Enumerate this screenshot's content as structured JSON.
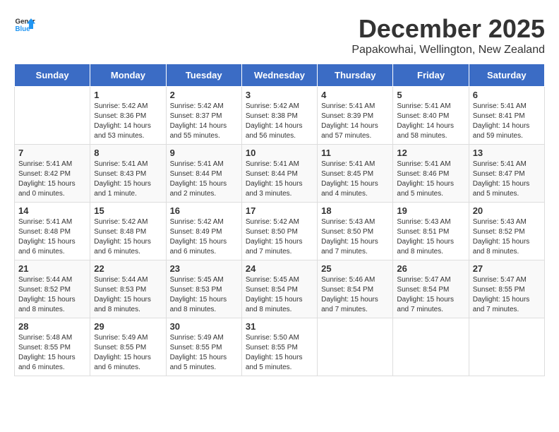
{
  "logo": {
    "text_general": "General",
    "text_blue": "Blue"
  },
  "title": "December 2025",
  "subtitle": "Papakowhai, Wellington, New Zealand",
  "headers": [
    "Sunday",
    "Monday",
    "Tuesday",
    "Wednesday",
    "Thursday",
    "Friday",
    "Saturday"
  ],
  "weeks": [
    [
      {
        "day": "",
        "info": ""
      },
      {
        "day": "1",
        "info": "Sunrise: 5:42 AM\nSunset: 8:36 PM\nDaylight: 14 hours\nand 53 minutes."
      },
      {
        "day": "2",
        "info": "Sunrise: 5:42 AM\nSunset: 8:37 PM\nDaylight: 14 hours\nand 55 minutes."
      },
      {
        "day": "3",
        "info": "Sunrise: 5:42 AM\nSunset: 8:38 PM\nDaylight: 14 hours\nand 56 minutes."
      },
      {
        "day": "4",
        "info": "Sunrise: 5:41 AM\nSunset: 8:39 PM\nDaylight: 14 hours\nand 57 minutes."
      },
      {
        "day": "5",
        "info": "Sunrise: 5:41 AM\nSunset: 8:40 PM\nDaylight: 14 hours\nand 58 minutes."
      },
      {
        "day": "6",
        "info": "Sunrise: 5:41 AM\nSunset: 8:41 PM\nDaylight: 14 hours\nand 59 minutes."
      }
    ],
    [
      {
        "day": "7",
        "info": "Sunrise: 5:41 AM\nSunset: 8:42 PM\nDaylight: 15 hours\nand 0 minutes."
      },
      {
        "day": "8",
        "info": "Sunrise: 5:41 AM\nSunset: 8:43 PM\nDaylight: 15 hours\nand 1 minute."
      },
      {
        "day": "9",
        "info": "Sunrise: 5:41 AM\nSunset: 8:44 PM\nDaylight: 15 hours\nand 2 minutes."
      },
      {
        "day": "10",
        "info": "Sunrise: 5:41 AM\nSunset: 8:44 PM\nDaylight: 15 hours\nand 3 minutes."
      },
      {
        "day": "11",
        "info": "Sunrise: 5:41 AM\nSunset: 8:45 PM\nDaylight: 15 hours\nand 4 minutes."
      },
      {
        "day": "12",
        "info": "Sunrise: 5:41 AM\nSunset: 8:46 PM\nDaylight: 15 hours\nand 5 minutes."
      },
      {
        "day": "13",
        "info": "Sunrise: 5:41 AM\nSunset: 8:47 PM\nDaylight: 15 hours\nand 5 minutes."
      }
    ],
    [
      {
        "day": "14",
        "info": "Sunrise: 5:41 AM\nSunset: 8:48 PM\nDaylight: 15 hours\nand 6 minutes."
      },
      {
        "day": "15",
        "info": "Sunrise: 5:42 AM\nSunset: 8:48 PM\nDaylight: 15 hours\nand 6 minutes."
      },
      {
        "day": "16",
        "info": "Sunrise: 5:42 AM\nSunset: 8:49 PM\nDaylight: 15 hours\nand 6 minutes."
      },
      {
        "day": "17",
        "info": "Sunrise: 5:42 AM\nSunset: 8:50 PM\nDaylight: 15 hours\nand 7 minutes."
      },
      {
        "day": "18",
        "info": "Sunrise: 5:43 AM\nSunset: 8:50 PM\nDaylight: 15 hours\nand 7 minutes."
      },
      {
        "day": "19",
        "info": "Sunrise: 5:43 AM\nSunset: 8:51 PM\nDaylight: 15 hours\nand 8 minutes."
      },
      {
        "day": "20",
        "info": "Sunrise: 5:43 AM\nSunset: 8:52 PM\nDaylight: 15 hours\nand 8 minutes."
      }
    ],
    [
      {
        "day": "21",
        "info": "Sunrise: 5:44 AM\nSunset: 8:52 PM\nDaylight: 15 hours\nand 8 minutes."
      },
      {
        "day": "22",
        "info": "Sunrise: 5:44 AM\nSunset: 8:53 PM\nDaylight: 15 hours\nand 8 minutes."
      },
      {
        "day": "23",
        "info": "Sunrise: 5:45 AM\nSunset: 8:53 PM\nDaylight: 15 hours\nand 8 minutes."
      },
      {
        "day": "24",
        "info": "Sunrise: 5:45 AM\nSunset: 8:54 PM\nDaylight: 15 hours\nand 8 minutes."
      },
      {
        "day": "25",
        "info": "Sunrise: 5:46 AM\nSunset: 8:54 PM\nDaylight: 15 hours\nand 7 minutes."
      },
      {
        "day": "26",
        "info": "Sunrise: 5:47 AM\nSunset: 8:54 PM\nDaylight: 15 hours\nand 7 minutes."
      },
      {
        "day": "27",
        "info": "Sunrise: 5:47 AM\nSunset: 8:55 PM\nDaylight: 15 hours\nand 7 minutes."
      }
    ],
    [
      {
        "day": "28",
        "info": "Sunrise: 5:48 AM\nSunset: 8:55 PM\nDaylight: 15 hours\nand 6 minutes."
      },
      {
        "day": "29",
        "info": "Sunrise: 5:49 AM\nSunset: 8:55 PM\nDaylight: 15 hours\nand 6 minutes."
      },
      {
        "day": "30",
        "info": "Sunrise: 5:49 AM\nSunset: 8:55 PM\nDaylight: 15 hours\nand 5 minutes."
      },
      {
        "day": "31",
        "info": "Sunrise: 5:50 AM\nSunset: 8:55 PM\nDaylight: 15 hours\nand 5 minutes."
      },
      {
        "day": "",
        "info": ""
      },
      {
        "day": "",
        "info": ""
      },
      {
        "day": "",
        "info": ""
      }
    ]
  ]
}
